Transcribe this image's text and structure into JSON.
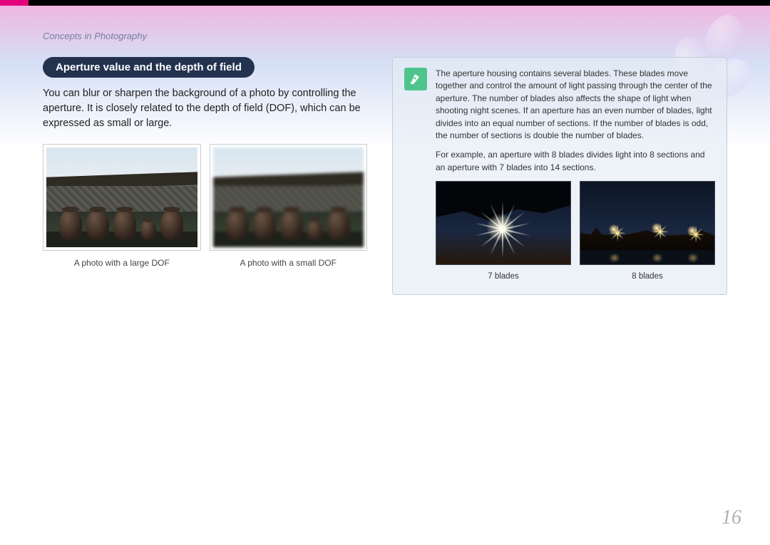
{
  "breadcrumb": "Concepts in Photography",
  "heading": "Aperture value and the depth of field",
  "intro": "You can blur or sharpen the background of a photo by controlling the aperture. It is closely related to the depth of field (DOF), which can be expressed as small or large.",
  "dof": {
    "large_caption": "A photo with a large DOF",
    "small_caption": "A photo with a small DOF"
  },
  "tip": {
    "p1": "The aperture housing contains several blades. These blades move together and control the amount of light passing through the center of the aperture. The number of blades also affects the shape of light when shooting night scenes. If an aperture has an even number of blades, light divides into an equal number of sections. If the number of blades is odd, the number of sections is double the number of blades.",
    "p2": "For example, an aperture with 8 blades divides light into 8 sections and an aperture with 7 blades into 14 sections.",
    "blade7_caption": "7 blades",
    "blade8_caption": "8 blades"
  },
  "page_number": "16"
}
